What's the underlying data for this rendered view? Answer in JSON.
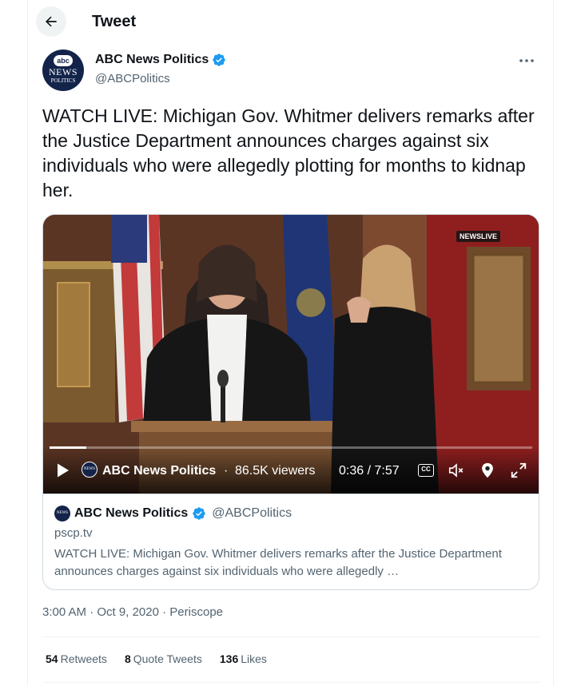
{
  "header": {
    "title": "Tweet",
    "back_icon": "arrow-left-icon"
  },
  "author": {
    "name": "ABC News Politics",
    "handle": "@ABCPolitics",
    "verified": true,
    "avatar": {
      "top": "abc",
      "middle": "NEWS",
      "bottom": "POLITICS"
    }
  },
  "tweet": {
    "text": "WATCH LIVE: Michigan Gov. Whitmer delivers remarks after the Justice Department announces charges against six individuals who were allegedly plotting for months to kidnap her."
  },
  "video": {
    "overlay_badge": "NEWSLIVE",
    "source_name": "ABC News Politics",
    "separator": "·",
    "viewers": "86.5K viewers",
    "time": "0:36 / 7:57",
    "cc_label": "CC",
    "progress_fraction": 0.076
  },
  "card": {
    "name": "ABC News Politics",
    "handle": "@ABCPolitics",
    "domain": "pscp.tv",
    "description": "WATCH LIVE: Michigan Gov. Whitmer delivers remarks after the Justice Department announces charges against six individuals who were allegedly …"
  },
  "meta": {
    "time": "3:00 AM",
    "sep1": " · ",
    "date": "Oct 9, 2020",
    "sep2": " · ",
    "source": "Periscope"
  },
  "stats": {
    "retweets_count": "54",
    "retweets_label": "Retweets",
    "quotes_count": "8",
    "quotes_label": "Quote Tweets",
    "likes_count": "136",
    "likes_label": "Likes"
  },
  "colors": {
    "verified": "#1d9bf0",
    "secondary_text": "#536471",
    "primary_text": "#0f1419",
    "border": "#cfd9de"
  }
}
